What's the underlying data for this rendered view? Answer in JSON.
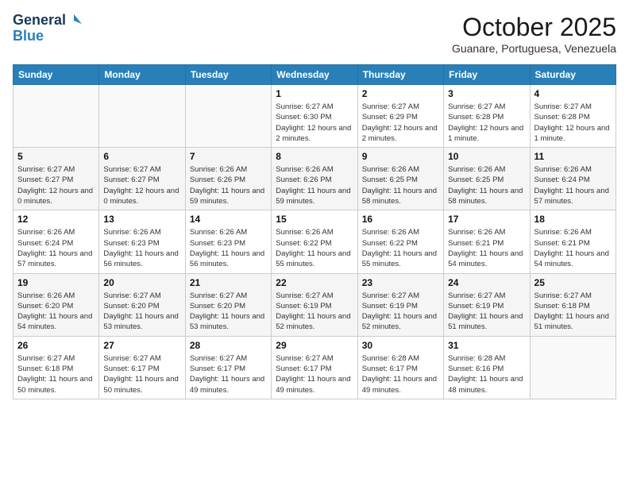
{
  "logo": {
    "line1": "General",
    "line2": "Blue"
  },
  "title": "October 2025",
  "subtitle": "Guanare, Portuguesa, Venezuela",
  "days_of_week": [
    "Sunday",
    "Monday",
    "Tuesday",
    "Wednesday",
    "Thursday",
    "Friday",
    "Saturday"
  ],
  "weeks": [
    [
      {
        "day": "",
        "info": ""
      },
      {
        "day": "",
        "info": ""
      },
      {
        "day": "",
        "info": ""
      },
      {
        "day": "1",
        "info": "Sunrise: 6:27 AM\nSunset: 6:30 PM\nDaylight: 12 hours and 2 minutes."
      },
      {
        "day": "2",
        "info": "Sunrise: 6:27 AM\nSunset: 6:29 PM\nDaylight: 12 hours and 2 minutes."
      },
      {
        "day": "3",
        "info": "Sunrise: 6:27 AM\nSunset: 6:28 PM\nDaylight: 12 hours and 1 minute."
      },
      {
        "day": "4",
        "info": "Sunrise: 6:27 AM\nSunset: 6:28 PM\nDaylight: 12 hours and 1 minute."
      }
    ],
    [
      {
        "day": "5",
        "info": "Sunrise: 6:27 AM\nSunset: 6:27 PM\nDaylight: 12 hours and 0 minutes."
      },
      {
        "day": "6",
        "info": "Sunrise: 6:27 AM\nSunset: 6:27 PM\nDaylight: 12 hours and 0 minutes."
      },
      {
        "day": "7",
        "info": "Sunrise: 6:26 AM\nSunset: 6:26 PM\nDaylight: 11 hours and 59 minutes."
      },
      {
        "day": "8",
        "info": "Sunrise: 6:26 AM\nSunset: 6:26 PM\nDaylight: 11 hours and 59 minutes."
      },
      {
        "day": "9",
        "info": "Sunrise: 6:26 AM\nSunset: 6:25 PM\nDaylight: 11 hours and 58 minutes."
      },
      {
        "day": "10",
        "info": "Sunrise: 6:26 AM\nSunset: 6:25 PM\nDaylight: 11 hours and 58 minutes."
      },
      {
        "day": "11",
        "info": "Sunrise: 6:26 AM\nSunset: 6:24 PM\nDaylight: 11 hours and 57 minutes."
      }
    ],
    [
      {
        "day": "12",
        "info": "Sunrise: 6:26 AM\nSunset: 6:24 PM\nDaylight: 11 hours and 57 minutes."
      },
      {
        "day": "13",
        "info": "Sunrise: 6:26 AM\nSunset: 6:23 PM\nDaylight: 11 hours and 56 minutes."
      },
      {
        "day": "14",
        "info": "Sunrise: 6:26 AM\nSunset: 6:23 PM\nDaylight: 11 hours and 56 minutes."
      },
      {
        "day": "15",
        "info": "Sunrise: 6:26 AM\nSunset: 6:22 PM\nDaylight: 11 hours and 55 minutes."
      },
      {
        "day": "16",
        "info": "Sunrise: 6:26 AM\nSunset: 6:22 PM\nDaylight: 11 hours and 55 minutes."
      },
      {
        "day": "17",
        "info": "Sunrise: 6:26 AM\nSunset: 6:21 PM\nDaylight: 11 hours and 54 minutes."
      },
      {
        "day": "18",
        "info": "Sunrise: 6:26 AM\nSunset: 6:21 PM\nDaylight: 11 hours and 54 minutes."
      }
    ],
    [
      {
        "day": "19",
        "info": "Sunrise: 6:26 AM\nSunset: 6:20 PM\nDaylight: 11 hours and 54 minutes."
      },
      {
        "day": "20",
        "info": "Sunrise: 6:27 AM\nSunset: 6:20 PM\nDaylight: 11 hours and 53 minutes."
      },
      {
        "day": "21",
        "info": "Sunrise: 6:27 AM\nSunset: 6:20 PM\nDaylight: 11 hours and 53 minutes."
      },
      {
        "day": "22",
        "info": "Sunrise: 6:27 AM\nSunset: 6:19 PM\nDaylight: 11 hours and 52 minutes."
      },
      {
        "day": "23",
        "info": "Sunrise: 6:27 AM\nSunset: 6:19 PM\nDaylight: 11 hours and 52 minutes."
      },
      {
        "day": "24",
        "info": "Sunrise: 6:27 AM\nSunset: 6:19 PM\nDaylight: 11 hours and 51 minutes."
      },
      {
        "day": "25",
        "info": "Sunrise: 6:27 AM\nSunset: 6:18 PM\nDaylight: 11 hours and 51 minutes."
      }
    ],
    [
      {
        "day": "26",
        "info": "Sunrise: 6:27 AM\nSunset: 6:18 PM\nDaylight: 11 hours and 50 minutes."
      },
      {
        "day": "27",
        "info": "Sunrise: 6:27 AM\nSunset: 6:17 PM\nDaylight: 11 hours and 50 minutes."
      },
      {
        "day": "28",
        "info": "Sunrise: 6:27 AM\nSunset: 6:17 PM\nDaylight: 11 hours and 49 minutes."
      },
      {
        "day": "29",
        "info": "Sunrise: 6:27 AM\nSunset: 6:17 PM\nDaylight: 11 hours and 49 minutes."
      },
      {
        "day": "30",
        "info": "Sunrise: 6:28 AM\nSunset: 6:17 PM\nDaylight: 11 hours and 49 minutes."
      },
      {
        "day": "31",
        "info": "Sunrise: 6:28 AM\nSunset: 6:16 PM\nDaylight: 11 hours and 48 minutes."
      },
      {
        "day": "",
        "info": ""
      }
    ]
  ]
}
